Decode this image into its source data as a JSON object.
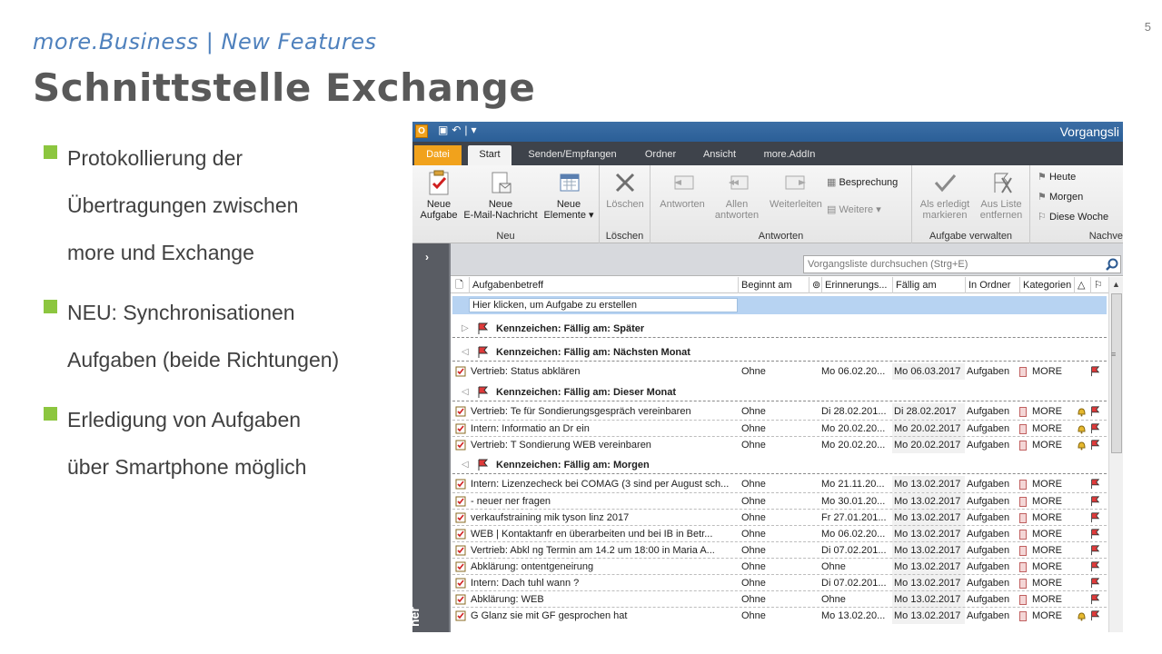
{
  "slide": {
    "page_number": "5",
    "subtitle": "more.Business | New Features",
    "title": "Schnittstelle Exchange",
    "bullets": [
      {
        "lines": [
          "Protokollierung der",
          "Übertragungen zwischen",
          "more und Exchange"
        ]
      },
      {
        "lines": [
          "NEU: Synchronisationen",
          "Aufgaben (beide Richtungen)"
        ]
      },
      {
        "lines": [
          "Erledigung von Aufgaben",
          "über Smartphone möglich"
        ]
      }
    ],
    "bullet_color": "#8cc63f"
  },
  "outlook": {
    "app_icon": "O",
    "window_title": "Vorgangsli",
    "tabs": [
      "Datei",
      "Start",
      "Senden/Empfangen",
      "Ordner",
      "Ansicht",
      "more.AddIn"
    ],
    "ribbon": {
      "neu": {
        "label": "Neu",
        "new_task": [
          "Neue",
          "Aufgabe"
        ],
        "new_email": [
          "Neue",
          "E-Mail-Nachricht"
        ],
        "new_items": [
          "Neue",
          "Elemente ▾"
        ]
      },
      "loeschen": {
        "label": "Löschen",
        "delete": "Löschen"
      },
      "antworten": {
        "label": "Antworten",
        "reply": "Antworten",
        "reply_all": [
          "Allen",
          "antworten"
        ],
        "forward": "Weiterleiten",
        "meeting": "Besprechung",
        "more": "Weitere ▾"
      },
      "aufgabe": {
        "label": "Aufgabe verwalten",
        "mark_done": [
          "Als erledigt",
          "markieren"
        ],
        "remove_list": [
          "Aus Liste",
          "entfernen"
        ]
      },
      "nachverfolgung": {
        "label": "Nachve",
        "today": "Heute",
        "tomorrow": "Morgen",
        "this_week": "Diese Woche"
      }
    },
    "nav_vertical": "ner",
    "search_placeholder": "Vorgangsliste durchsuchen (Strg+E)",
    "columns": [
      "Aufgabenbetreff",
      "Beginnt am",
      "Erinnerungs...",
      "Fällig am",
      "In Ordner",
      "Kategorien"
    ],
    "new_task_prompt": "Hier klicken, um Aufgabe zu erstellen",
    "groups": [
      {
        "label": "Kennzeichen: Fällig am: Später",
        "collapsed": true,
        "rows": []
      },
      {
        "label": "Kennzeichen: Fällig am: Nächsten Monat",
        "collapsed": false,
        "rows": [
          {
            "subject": "Vertrieb: Status abklären",
            "start": "Ohne",
            "reminder": "Mo 06.02.20...",
            "due": "Mo 06.03.2017",
            "folder": "Aufgaben",
            "category": "MORE",
            "bell": false
          }
        ]
      },
      {
        "label": "Kennzeichen: Fällig am: Dieser Monat",
        "collapsed": false,
        "rows": [
          {
            "subject": "Vertrieb: Te    für Sondierungsgespräch vereinbaren",
            "start": "Ohne",
            "reminder": "Di 28.02.201...",
            "due": "Di 28.02.2017",
            "folder": "Aufgaben",
            "category": "MORE",
            "bell": true
          },
          {
            "subject": "Intern: Informatio   an Dr     ein",
            "start": "Ohne",
            "reminder": "Mo 20.02.20...",
            "due": "Mo 20.02.2017",
            "folder": "Aufgaben",
            "category": "MORE",
            "bell": true
          },
          {
            "subject": "Vertrieb: T       Sondierung WEB vereinbaren",
            "start": "Ohne",
            "reminder": "Mo 20.02.20...",
            "due": "Mo 20.02.2017",
            "folder": "Aufgaben",
            "category": "MORE",
            "bell": true
          }
        ]
      },
      {
        "label": "Kennzeichen: Fällig am: Morgen",
        "collapsed": false,
        "rows": [
          {
            "subject": "Intern: Lizenzecheck bei COMAG (3 sind per August sch...",
            "start": "Ohne",
            "reminder": "Mo 21.11.20...",
            "due": "Mo 13.02.2017",
            "folder": "Aufgaben",
            "category": "MORE",
            "bell": false
          },
          {
            "subject": "      - neuer       ner fragen",
            "start": "Ohne",
            "reminder": "Mo 30.01.20...",
            "due": "Mo 13.02.2017",
            "folder": "Aufgaben",
            "category": "MORE",
            "bell": false
          },
          {
            "subject": "verkaufstraining mik  tyson linz 2017",
            "start": "Ohne",
            "reminder": "Fr 27.01.201...",
            "due": "Mo 13.02.2017",
            "folder": "Aufgaben",
            "category": "MORE",
            "bell": false
          },
          {
            "subject": "WEB | Kontaktanfr   en überarbeiten und bei IB in Betr...",
            "start": "Ohne",
            "reminder": "Mo 06.02.20...",
            "due": "Mo 13.02.2017",
            "folder": "Aufgaben",
            "category": "MORE",
            "bell": false
          },
          {
            "subject": "Vertrieb: Abkl    ng Termin am 14.2 um 18:00 in Maria A...",
            "start": "Ohne",
            "reminder": "Di 07.02.201...",
            "due": "Mo 13.02.2017",
            "folder": "Aufgaben",
            "category": "MORE",
            "bell": false
          },
          {
            "subject": "Abklärung:    ontentgeneirung",
            "start": "Ohne",
            "reminder": "Ohne",
            "due": "Mo 13.02.2017",
            "folder": "Aufgaben",
            "category": "MORE",
            "bell": false
          },
          {
            "subject": "Intern: Dach  tuhl wann ?",
            "start": "Ohne",
            "reminder": "Di 07.02.201...",
            "due": "Mo 13.02.2017",
            "folder": "Aufgaben",
            "category": "MORE",
            "bell": false
          },
          {
            "subject": "Abklärung:        WEB",
            "start": "Ohne",
            "reminder": "Ohne",
            "due": "Mo 13.02.2017",
            "folder": "Aufgaben",
            "category": "MORE",
            "bell": false
          },
          {
            "subject": "G   Glanz        sie mit GF  gesprochen hat",
            "start": "Ohne",
            "reminder": "Mo 13.02.20...",
            "due": "Mo 13.02.2017",
            "folder": "Aufgaben",
            "category": "MORE",
            "bell": true
          }
        ]
      }
    ]
  }
}
